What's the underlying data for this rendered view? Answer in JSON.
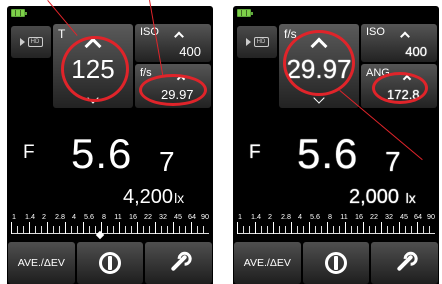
{
  "left": {
    "t_label": "T",
    "t_value": "125",
    "iso_label": "ISO",
    "iso_value": "400",
    "fs_label": "f/s",
    "fs_value": "29.97",
    "f_label": "F",
    "f_main": "5.6",
    "f_tenth": "7",
    "lux_value": "4,200",
    "lux_unit": "lx",
    "scale": [
      "1",
      "1.4",
      "2",
      "2.8",
      "4",
      "5.6",
      "8",
      "11",
      "16",
      "22",
      "32",
      "45",
      "64",
      "90"
    ],
    "bottom": {
      "ave_label": "AVE./ΔEV",
      "memory_icon": "memory-icon",
      "settings_icon": "wrench-icon"
    }
  },
  "right": {
    "t_label": "f/s",
    "t_value": "29.97",
    "iso_label": "ISO",
    "iso_value": "400",
    "fs_label": "ANG",
    "fs_value": "172.8",
    "f_label": "F",
    "f_main": "5.6",
    "f_tenth": "7",
    "lux_value": "2,000",
    "lux_unit": "lx",
    "scale": [
      "1",
      "1.4",
      "2",
      "2.8",
      "4",
      "5.6",
      "8",
      "11",
      "16",
      "22",
      "32",
      "45",
      "64",
      "90"
    ],
    "bottom": {
      "ave_label": "AVE./ΔEV",
      "memory_icon": "memory-icon",
      "settings_icon": "wrench-icon"
    }
  },
  "colors": {
    "annotation": "#e0242a",
    "battery": "#7fd14a",
    "background": "#000000"
  }
}
